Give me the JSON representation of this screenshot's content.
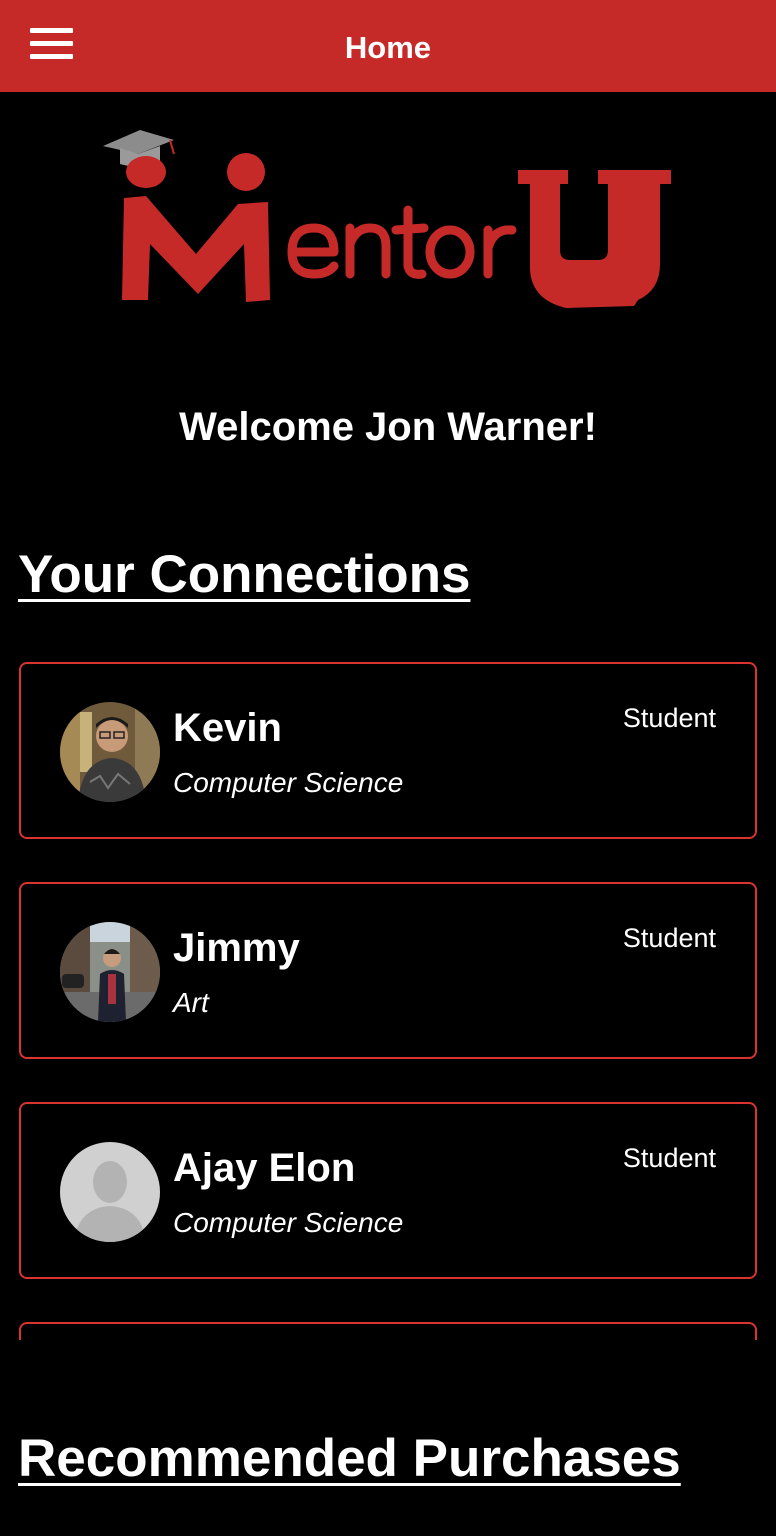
{
  "header": {
    "title": "Home",
    "menu_icon": "hamburger-menu-icon"
  },
  "logo": {
    "text": "MentorU",
    "color": "#c62a28"
  },
  "welcome": {
    "text": "Welcome Jon Warner!"
  },
  "connections": {
    "title": "Your Connections",
    "items": [
      {
        "name": "Kevin",
        "major": "Computer Science",
        "role": "Student",
        "avatar": "profile-photo"
      },
      {
        "name": "Jimmy",
        "major": "Art",
        "role": "Student",
        "avatar": "profile-photo"
      },
      {
        "name": "Ajay Elon",
        "major": "Computer Science",
        "role": "Student",
        "avatar": "default-avatar-icon"
      }
    ]
  },
  "purchases": {
    "title": "Recommended Purchases"
  },
  "colors": {
    "accent": "#c62a28",
    "card_border": "#d9342f",
    "background": "#000000",
    "text": "#ffffff"
  }
}
